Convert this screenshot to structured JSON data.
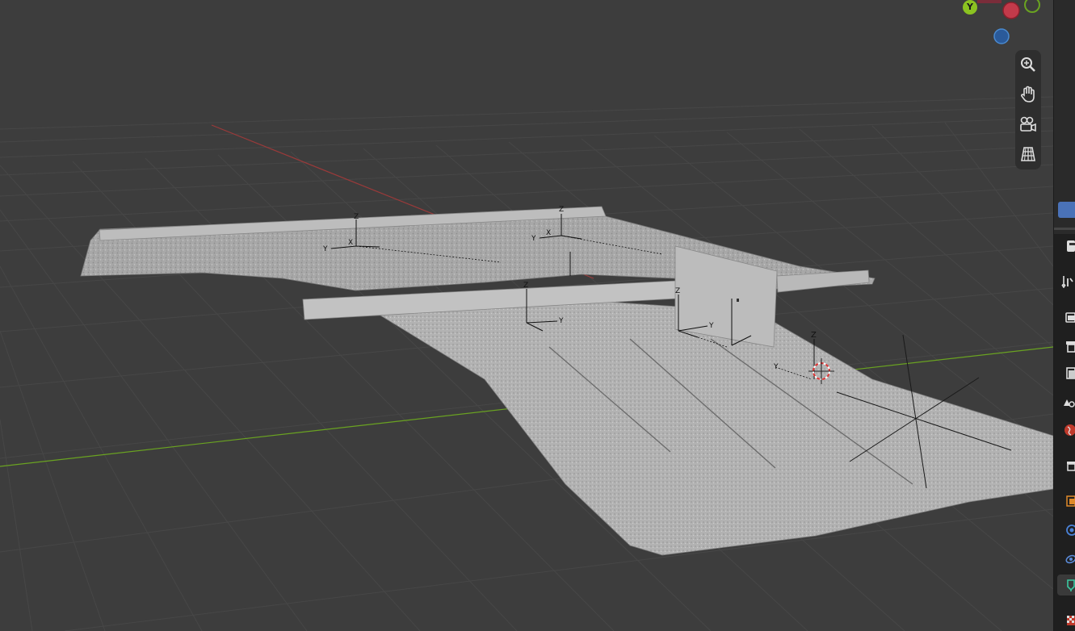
{
  "app": {
    "name": "Blender 3D Viewport"
  },
  "gizmo": {
    "y_label": "Y",
    "colors": {
      "x": "#d9344a",
      "y": "#8bc321",
      "z": "#2f78d0"
    }
  },
  "nav_controls": [
    {
      "name": "zoom-icon",
      "label": "Zoom"
    },
    {
      "name": "hand-pan-icon",
      "label": "Move"
    },
    {
      "name": "camera-view-icon",
      "label": "Camera"
    },
    {
      "name": "grid-ortho-icon",
      "label": "Perspective/Orthographic"
    }
  ],
  "empties": [
    {
      "name": "empty-1",
      "z": "Z",
      "y": "Y",
      "x": "X"
    },
    {
      "name": "empty-2",
      "z": "Z",
      "y": "Y",
      "x": "X"
    },
    {
      "name": "empty-3",
      "z": "Z",
      "y": "Y",
      "x": "X"
    },
    {
      "name": "empty-4",
      "z": "Z",
      "y": "Y",
      "x": "X"
    },
    {
      "name": "empty-5",
      "z": "Z",
      "y": "Y",
      "x": "X"
    }
  ],
  "properties_tabs": [
    "tool-icon",
    "render-icon",
    "output-icon",
    "view-layer-icon",
    "scene-icon",
    "world-icon",
    "collection-icon",
    "object-icon",
    "modifier-icon",
    "particles-icon",
    "physics-icon",
    "texture-icon"
  ],
  "colors": {
    "background": "#3d3d3d",
    "grid": "#474747",
    "x_axis": "#b03a3a",
    "y_axis": "#6aa321",
    "mesh": "#a9a9a9"
  }
}
